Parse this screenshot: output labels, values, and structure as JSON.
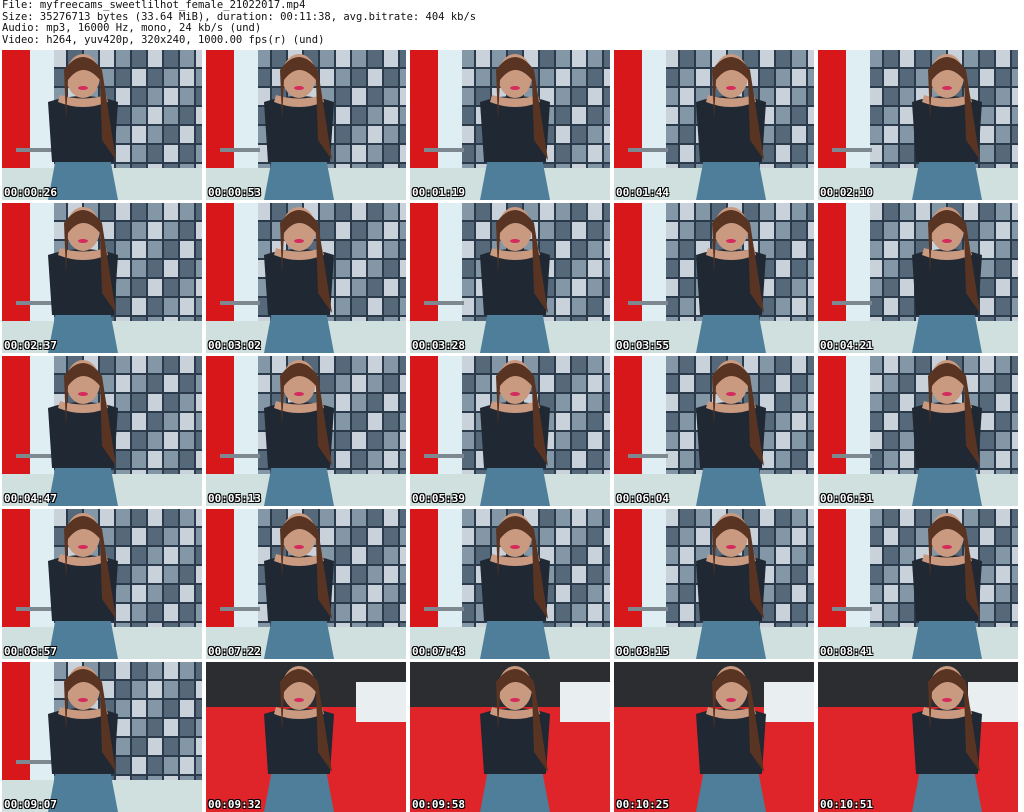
{
  "header": {
    "file": "File: myfreecams_sweetlilhot_female_21022017.mp4",
    "size": "Size: 35276713 bytes (33.64 MiB), duration: 00:11:38, avg.bitrate: 404 kb/s",
    "audio": "Audio: mp3, 16000 Hz, mono, 24 kb/s (und)",
    "video": "Video: h264, yuv420p, 320x240, 1000.00 fps(r) (und)"
  },
  "thumbnails": [
    {
      "time": "00:00:26",
      "bg": "red-wall"
    },
    {
      "time": "00:00:53",
      "bg": "red-wall"
    },
    {
      "time": "00:01:19",
      "bg": "red-wall"
    },
    {
      "time": "00:01:44",
      "bg": "red-wall"
    },
    {
      "time": "00:02:10",
      "bg": "red-wall"
    },
    {
      "time": "00:02:37",
      "bg": "red-wall"
    },
    {
      "time": "00:03:02",
      "bg": "red-wall"
    },
    {
      "time": "00:03:28",
      "bg": "red-wall"
    },
    {
      "time": "00:03:55",
      "bg": "red-wall"
    },
    {
      "time": "00:04:21",
      "bg": "red-wall"
    },
    {
      "time": "00:04:47",
      "bg": "red-wall"
    },
    {
      "time": "00:05:13",
      "bg": "red-wall"
    },
    {
      "time": "00:05:39",
      "bg": "red-wall"
    },
    {
      "time": "00:06:04",
      "bg": "red-wall"
    },
    {
      "time": "00:06:31",
      "bg": "red-wall"
    },
    {
      "time": "00:06:57",
      "bg": "red-wall"
    },
    {
      "time": "00:07:22",
      "bg": "red-wall"
    },
    {
      "time": "00:07:48",
      "bg": "red-wall"
    },
    {
      "time": "00:08:15",
      "bg": "red-wall"
    },
    {
      "time": "00:08:41",
      "bg": "red-wall"
    },
    {
      "time": "00:09:07",
      "bg": "red-wall"
    },
    {
      "time": "00:09:32",
      "bg": "red-bed"
    },
    {
      "time": "00:09:58",
      "bg": "red-bed"
    },
    {
      "time": "00:10:25",
      "bg": "red-bed"
    },
    {
      "time": "00:10:51",
      "bg": "red-bed"
    }
  ],
  "colors": {
    "curtain": "#d8171b",
    "wall": "#2a3a4a",
    "window": "#dfeef3",
    "skin": "#c99a80",
    "top": "#1f2833",
    "jeans": "#4f7e9a",
    "hair": "#5a3422",
    "bed": "#e0252a"
  }
}
